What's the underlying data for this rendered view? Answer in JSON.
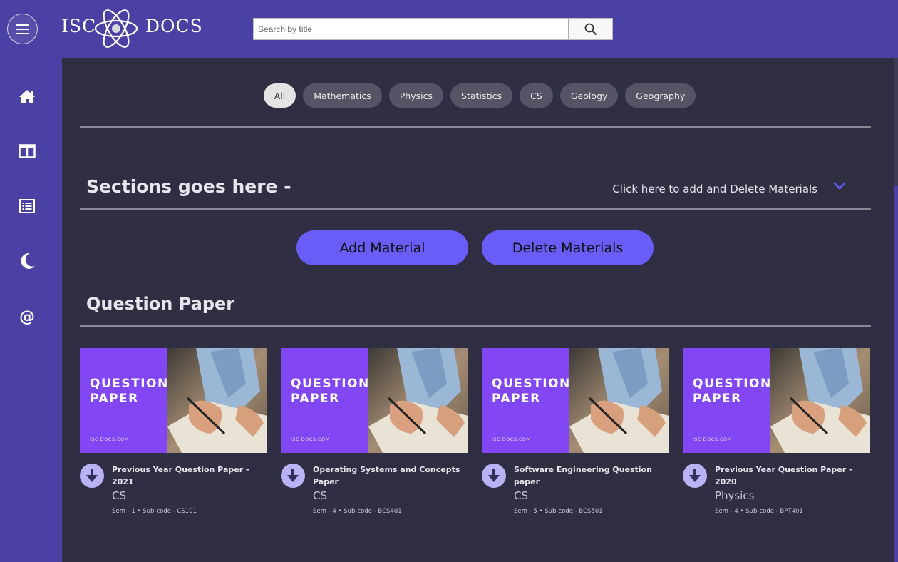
{
  "header": {
    "logo_left": "ISC",
    "logo_right": "DOCS",
    "search": {
      "placeholder": "Search by title"
    }
  },
  "sidebar": {
    "items": [
      {
        "name": "home",
        "icon": "home-icon"
      },
      {
        "name": "layout",
        "icon": "columns-icon"
      },
      {
        "name": "list",
        "icon": "list-icon"
      },
      {
        "name": "theme",
        "icon": "moon-icon"
      },
      {
        "name": "contact",
        "icon": "at-icon"
      }
    ]
  },
  "filters": [
    "All",
    "Mathematics",
    "Physics",
    "Statistics",
    "CS",
    "Geology",
    "Geography"
  ],
  "sections": {
    "heading": "Sections goes here -",
    "toggle_text": "Click here to add and Delete Materials",
    "add_button": "Add Material",
    "delete_button": "Delete Materials"
  },
  "question_paper": {
    "heading": "Question Paper",
    "thumb_title_1": "QUESTION",
    "thumb_title_2": "PAPER",
    "thumb_site": "ISC DOCS.COM",
    "cards": [
      {
        "title": "Previous Year Question Paper - 2021",
        "subject": "CS",
        "sem": "Sem - 1",
        "subcode": "Sub-code - CS101"
      },
      {
        "title": "Operating Systems and Concepts Paper",
        "subject": "CS",
        "sem": "Sem - 4",
        "subcode": "Sub-code - BCS401"
      },
      {
        "title": "Software Engineering Question paper",
        "subject": "CS",
        "sem": "Sem - 5",
        "subcode": "Sub-code - BCS501"
      },
      {
        "title": "Previous Year Question Paper - 2020",
        "subject": "Physics",
        "sem": "Sem - 4",
        "subcode": "Sub-code - BPT401"
      }
    ]
  },
  "colors": {
    "header_bg": "#4b40a3",
    "main_bg": "#302e42",
    "accent": "#6a5cf6",
    "thumb_purple": "#8246f4"
  }
}
